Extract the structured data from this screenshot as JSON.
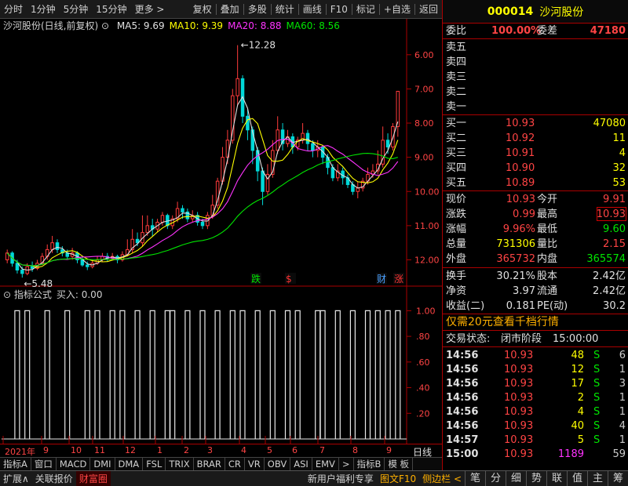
{
  "toolbar": {
    "items": [
      "分时",
      "1分钟",
      "5分钟",
      "15分钟",
      "更多 >"
    ],
    "right_items": [
      "复权",
      "叠加",
      "多股",
      "统计",
      "画线",
      "F10",
      "标记",
      "+自选",
      "返回"
    ]
  },
  "chart_header": {
    "title": "沙河股份(日线,前复权)",
    "ma5": "MA5: 9.69",
    "ma10": "MA10: 9.39",
    "ma20": "MA20: 8.88",
    "ma60": "MA60: 8.56"
  },
  "indicator_header": {
    "title": "指标公式",
    "value": "买入: 0.00"
  },
  "markers": {
    "die": "跌",
    "dollar": "$",
    "cai": "财",
    "zhang": "涨"
  },
  "annotations": {
    "high": "12.28",
    "low": "5.48"
  },
  "x_labels": [
    "2021年",
    "9",
    "10",
    "11",
    "12",
    "1",
    "2",
    "3",
    "4",
    "5",
    "6",
    "7",
    "8",
    "9"
  ],
  "x_right": "日线",
  "price_axis": [
    "12.00",
    "11.00",
    "10.00",
    "9.00",
    "8.00",
    "7.00",
    "6.00"
  ],
  "ind_axis": [
    "1.00",
    ".80",
    ".60",
    ".40",
    ".20"
  ],
  "bottom_tabs": [
    "指标A",
    "窗口",
    "MACD",
    "DMI",
    "DMA",
    "FSL",
    "TRIX",
    "BRAR",
    "CR",
    "VR",
    "OBV",
    "ASI",
    "EMV",
    ">",
    "指标B",
    "模 板"
  ],
  "status": {
    "left": [
      "扩展∧",
      "关联报价"
    ],
    "active": "财富圈",
    "mid": [
      "新用户福利专享"
    ],
    "right": [
      "图文F10",
      "侧边栏 <"
    ],
    "icons": [
      "笔",
      "分",
      "细",
      "势",
      "联",
      "值",
      "主",
      "筹"
    ]
  },
  "panel": {
    "code": "000014",
    "name": "沙河股份",
    "weibi_label": "委比",
    "weibi_value": "100.00%",
    "weicha_label": "委差",
    "weicha_value": "47180",
    "sell": [
      {
        "label": "卖五"
      },
      {
        "label": "卖四"
      },
      {
        "label": "卖三"
      },
      {
        "label": "卖二"
      },
      {
        "label": "卖一"
      }
    ],
    "buy": [
      {
        "label": "买一",
        "price": "10.93",
        "vol": "47080"
      },
      {
        "label": "买二",
        "price": "10.92",
        "vol": "11"
      },
      {
        "label": "买三",
        "price": "10.91",
        "vol": "4"
      },
      {
        "label": "买四",
        "price": "10.90",
        "vol": "32"
      },
      {
        "label": "买五",
        "price": "10.89",
        "vol": "53"
      }
    ],
    "quote": [
      {
        "l1": "现价",
        "v1": "10.93",
        "l2": "今开",
        "v2": "9.91"
      },
      {
        "l1": "涨跌",
        "v1": "0.99",
        "l2": "最高",
        "v2": "10.93"
      },
      {
        "l1": "涨幅",
        "v1": "9.96%",
        "l2": "最低",
        "v2": "9.60"
      },
      {
        "l1": "总量",
        "v1": "731306",
        "l2": "量比",
        "v2": "2.15"
      },
      {
        "l1": "外盘",
        "v1": "365732",
        "l2": "内盘",
        "v2": "365574"
      }
    ],
    "stats": [
      {
        "l1": "换手",
        "v1": "30.21%",
        "l2": "股本",
        "v2": "2.42亿"
      },
      {
        "l1": "净资",
        "v1": "3.97",
        "l2": "流通",
        "v2": "2.42亿"
      },
      {
        "l1": "收益(二)",
        "v1": "0.181",
        "l2": "PE(动)",
        "v2": "30.2"
      }
    ],
    "promo": "仅需20元查看千档行情",
    "trade_status_label": "交易状态:",
    "trade_status": "闭市阶段",
    "trade_time": "15:00:00",
    "ticks": [
      {
        "t": "14:56",
        "p": "10.93",
        "v": "48",
        "s": "S",
        "n": "6"
      },
      {
        "t": "14:56",
        "p": "10.93",
        "v": "12",
        "s": "S",
        "n": "1"
      },
      {
        "t": "14:56",
        "p": "10.93",
        "v": "17",
        "s": "S",
        "n": "3"
      },
      {
        "t": "14:56",
        "p": "10.93",
        "v": "2",
        "s": "S",
        "n": "1"
      },
      {
        "t": "14:56",
        "p": "10.93",
        "v": "4",
        "s": "S",
        "n": "1"
      },
      {
        "t": "14:56",
        "p": "10.93",
        "v": "40",
        "s": "S",
        "n": "4"
      },
      {
        "t": "14:57",
        "p": "10.93",
        "v": "5",
        "s": "S",
        "n": "1"
      },
      {
        "t": "15:00",
        "p": "10.93",
        "v": "1189",
        "s": "",
        "n": "59"
      }
    ]
  },
  "chart_data": {
    "type": "candlestick",
    "title": "沙河股份(日线,前复权)",
    "ylim": [
      5.3,
      12.5
    ],
    "y_ticks": [
      6,
      7,
      8,
      9,
      10,
      11,
      12
    ],
    "x_months": [
      "2021年",
      "9",
      "10",
      "11",
      "12",
      "1",
      "2",
      "3",
      "4",
      "5",
      "6",
      "7",
      "8",
      "9"
    ],
    "candles": [
      [
        6.0,
        6.2,
        6.3,
        5.9
      ],
      [
        6.2,
        5.9,
        6.25,
        5.8
      ],
      [
        5.9,
        5.7,
        6.0,
        5.6
      ],
      [
        5.7,
        5.6,
        5.8,
        5.48
      ],
      [
        5.6,
        5.8,
        5.9,
        5.55
      ],
      [
        5.8,
        5.75,
        5.95,
        5.65
      ],
      [
        5.75,
        5.9,
        6.0,
        5.7
      ],
      [
        5.9,
        6.1,
        6.2,
        5.85
      ],
      [
        6.1,
        6.3,
        6.45,
        6.0
      ],
      [
        6.3,
        6.5,
        6.7,
        6.2
      ],
      [
        6.5,
        6.3,
        6.6,
        6.2
      ],
      [
        6.3,
        6.2,
        6.4,
        6.1
      ],
      [
        6.2,
        6.1,
        6.3,
        6.0
      ],
      [
        6.1,
        6.2,
        6.35,
        6.0
      ],
      [
        6.2,
        6.0,
        6.25,
        5.9
      ],
      [
        6.0,
        5.85,
        6.1,
        5.8
      ],
      [
        5.85,
        5.8,
        5.95,
        5.7
      ],
      [
        5.8,
        5.9,
        6.0,
        5.75
      ],
      [
        5.9,
        6.0,
        6.1,
        5.85
      ],
      [
        6.0,
        6.1,
        6.2,
        5.95
      ],
      [
        6.1,
        6.05,
        6.2,
        5.95
      ],
      [
        6.05,
        6.1,
        6.2,
        6.0
      ],
      [
        6.1,
        6.0,
        6.15,
        5.9
      ],
      [
        6.0,
        6.15,
        6.25,
        5.95
      ],
      [
        6.15,
        6.3,
        6.6,
        6.1
      ],
      [
        6.3,
        6.6,
        6.9,
        6.2
      ],
      [
        6.6,
        6.5,
        6.8,
        6.4
      ],
      [
        6.5,
        6.8,
        7.3,
        6.4
      ],
      [
        6.8,
        7.0,
        7.3,
        6.7
      ],
      [
        7.0,
        6.9,
        7.2,
        6.7
      ],
      [
        6.9,
        7.1,
        7.2,
        6.8
      ],
      [
        7.1,
        7.3,
        7.4,
        7.0
      ],
      [
        7.3,
        7.0,
        7.35,
        6.9
      ],
      [
        7.0,
        7.2,
        7.3,
        6.9
      ],
      [
        7.2,
        7.5,
        7.7,
        7.1
      ],
      [
        7.5,
        7.4,
        7.6,
        7.2
      ],
      [
        7.4,
        7.2,
        7.5,
        7.1
      ],
      [
        7.2,
        7.3,
        7.45,
        7.1
      ],
      [
        7.3,
        7.1,
        7.4,
        7.0
      ],
      [
        7.1,
        7.0,
        7.2,
        6.9
      ],
      [
        7.0,
        7.3,
        7.4,
        6.9
      ],
      [
        7.3,
        7.6,
        7.9,
        7.2
      ],
      [
        7.6,
        8.3,
        8.4,
        7.5
      ],
      [
        8.3,
        9.0,
        9.3,
        8.2
      ],
      [
        9.0,
        9.5,
        9.8,
        8.8
      ],
      [
        9.5,
        10.8,
        11.0,
        9.4
      ],
      [
        10.8,
        11.3,
        12.28,
        10.5
      ],
      [
        11.3,
        10.2,
        11.4,
        10.0
      ],
      [
        10.2,
        9.8,
        10.4,
        9.5
      ],
      [
        9.8,
        9.2,
        9.9,
        8.8
      ],
      [
        9.2,
        8.6,
        9.3,
        8.3
      ],
      [
        8.6,
        8.0,
        8.7,
        7.6
      ],
      [
        8.0,
        8.5,
        8.8,
        7.9
      ],
      [
        8.5,
        9.2,
        9.5,
        8.4
      ],
      [
        9.2,
        9.8,
        10.2,
        9.1
      ],
      [
        9.8,
        9.4,
        10.0,
        9.2
      ],
      [
        9.4,
        9.6,
        9.8,
        9.3
      ],
      [
        9.6,
        9.3,
        9.7,
        9.1
      ],
      [
        9.3,
        9.5,
        9.6,
        9.2
      ],
      [
        9.5,
        9.7,
        10.0,
        9.4
      ],
      [
        9.7,
        9.4,
        9.8,
        9.2
      ],
      [
        9.4,
        9.2,
        9.5,
        9.0
      ],
      [
        9.2,
        9.3,
        9.5,
        9.0
      ],
      [
        9.3,
        9.0,
        9.35,
        8.8
      ],
      [
        9.0,
        8.7,
        9.1,
        8.5
      ],
      [
        8.7,
        8.4,
        8.8,
        8.3
      ],
      [
        8.4,
        8.6,
        8.8,
        8.3
      ],
      [
        8.6,
        8.4,
        8.7,
        8.2
      ],
      [
        8.4,
        8.2,
        8.5,
        8.1
      ],
      [
        8.2,
        8.0,
        8.3,
        7.9
      ],
      [
        8.0,
        8.1,
        8.3,
        7.8
      ],
      [
        8.1,
        8.3,
        8.4,
        8.0
      ],
      [
        8.3,
        8.5,
        8.7,
        8.2
      ],
      [
        8.5,
        8.6,
        8.8,
        8.4
      ],
      [
        8.6,
        8.8,
        9.2,
        8.5
      ],
      [
        8.8,
        9.5,
        9.9,
        8.7
      ],
      [
        9.5,
        9.3,
        9.7,
        9.1
      ],
      [
        9.3,
        9.9,
        10.0,
        9.2
      ],
      [
        9.9,
        10.93,
        10.93,
        9.6
      ]
    ],
    "ma_series": [
      "MA5",
      "MA10",
      "MA20",
      "MA60"
    ],
    "indicator": {
      "name": "买入",
      "ylim": [
        0,
        1.1
      ],
      "signal_bars": [
        2,
        4,
        8,
        12,
        16,
        18,
        21,
        23,
        26,
        29,
        32,
        33,
        36,
        39,
        42,
        45,
        47,
        50,
        53,
        56,
        58,
        62,
        63,
        66,
        69,
        72,
        74,
        76,
        78
      ]
    }
  }
}
